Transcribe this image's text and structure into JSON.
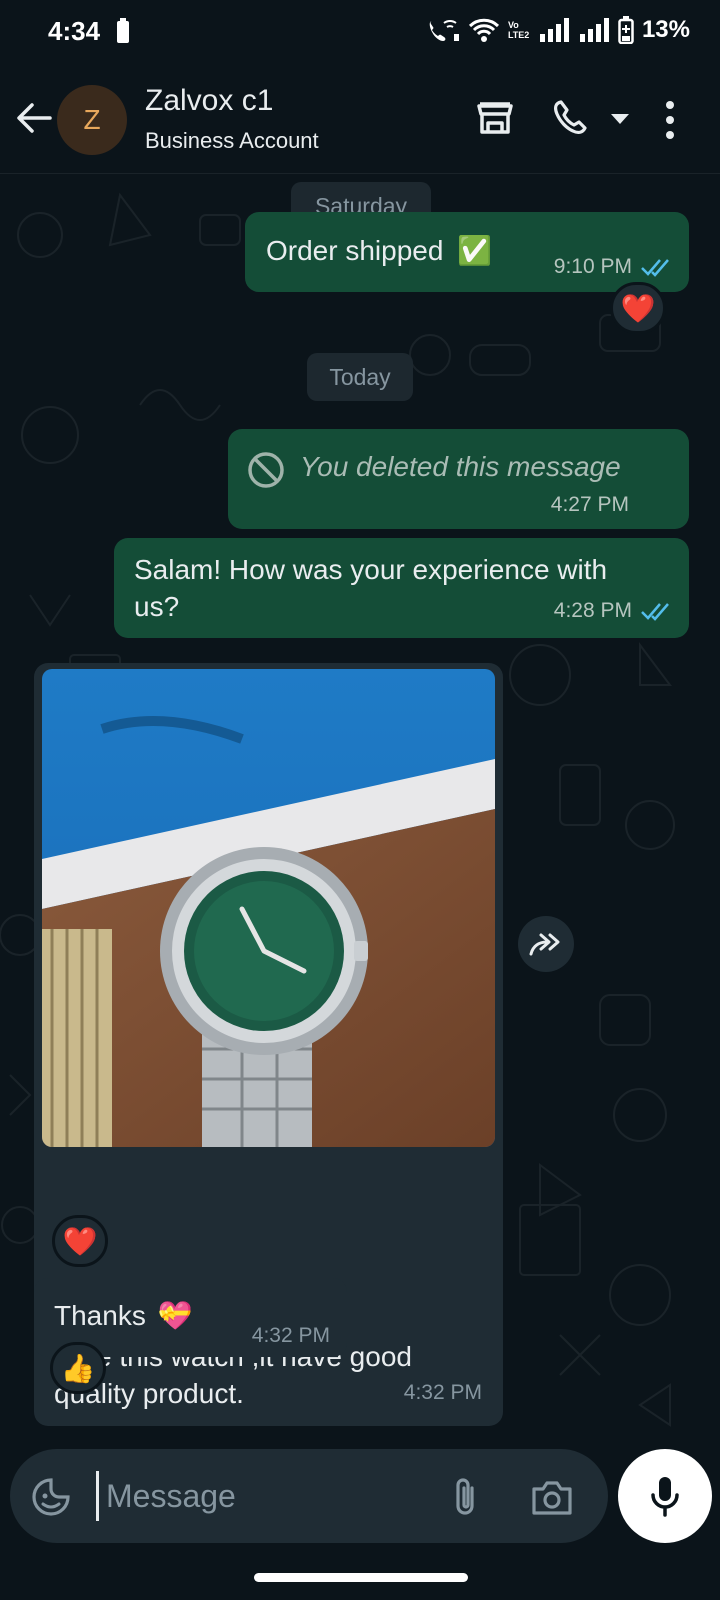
{
  "status_bar": {
    "time": "4:34",
    "battery_percent": "13%",
    "volte_label": "Vo LTE2"
  },
  "header": {
    "contact_name": "Zalvox c1",
    "contact_subtitle": "Business Account",
    "avatar_initial": "Z"
  },
  "messages": [
    {
      "type": "date",
      "label": "Saturday"
    },
    {
      "type": "outgoing",
      "text": "Order shipped",
      "emoji": "✅",
      "time": "9:10 PM",
      "status": "read",
      "reaction": "❤️"
    },
    {
      "type": "date",
      "label": "Today"
    },
    {
      "type": "outgoing-deleted",
      "text": "You deleted this message",
      "time": "4:27 PM"
    },
    {
      "type": "outgoing",
      "text": "Salam! How was your experience with us?",
      "time": "4:28 PM",
      "status": "read"
    },
    {
      "type": "incoming-image",
      "caption": "I like this watch ,it have good quality product.",
      "time": "4:32 PM",
      "reaction": "❤️"
    },
    {
      "type": "incoming",
      "text": "Thanks",
      "emoji": "💝",
      "time": "4:32 PM",
      "reaction": "👍"
    }
  ],
  "input": {
    "placeholder": "Message"
  },
  "colors": {
    "background": "#0b141a",
    "outgoing_bubble": "#144d37",
    "incoming_bubble": "#1f2c34",
    "read_ticks": "#53bdeb"
  },
  "icons": [
    "back-arrow-icon",
    "store-icon",
    "call-icon",
    "menu-icon",
    "forward-icon",
    "sticker-icon",
    "attach-icon",
    "camera-icon",
    "mic-icon"
  ]
}
